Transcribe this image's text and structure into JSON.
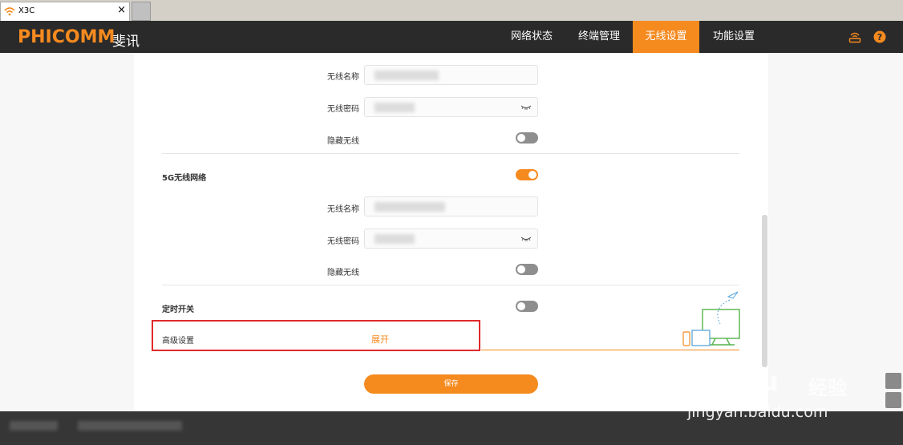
{
  "browser": {
    "tab_title": "X3C",
    "tab_close": "×"
  },
  "header": {
    "logo_text": "PHICOMM",
    "logo_cn": "斐讯",
    "nav": [
      {
        "label": "网络状态",
        "active": false
      },
      {
        "label": "终端管理",
        "active": false
      },
      {
        "label": "无线设置",
        "active": true
      },
      {
        "label": "功能设置",
        "active": false
      }
    ],
    "accent_color": "#f58a1f"
  },
  "wifi24": {
    "name_label": "无线名称",
    "password_label": "无线密码",
    "hide_label": "隐藏无线",
    "hide_on": false
  },
  "wifi5g": {
    "section_label": "5G无线网络",
    "enabled": true,
    "name_label": "无线名称",
    "password_label": "无线密码",
    "hide_label": "隐藏无线",
    "hide_on": false
  },
  "timer": {
    "label": "定时开关",
    "on": false
  },
  "advanced": {
    "label": "高级设置",
    "expand_label": "展开"
  },
  "save_label": "保存",
  "watermark": {
    "brand": "Baidu",
    "cn": "经验",
    "url": "jingyan.baidu.com"
  }
}
